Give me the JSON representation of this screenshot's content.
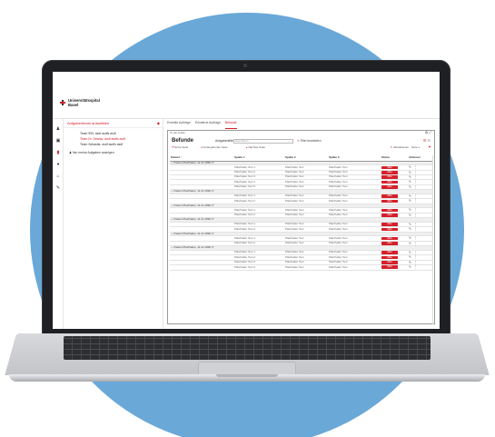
{
  "brand": {
    "line1": "Universitätsspital",
    "line2": "Basel"
  },
  "tasks": {
    "header": "Aufgabenteam auswählen",
    "teams": [
      {
        "label": "Team 990, asdf asdfs asdf",
        "active": false
      },
      {
        "label": "Team Dr. Sewiss, asdf asdfs asdf",
        "active": true
      },
      {
        "label": "Team Sebastia, asdf asdfs asdf",
        "active": false
      }
    ],
    "mine": "Nur meine Aufgaben anzeigen"
  },
  "tabs": [
    {
      "label": "Erstellte Aufträge",
      "active": false
    },
    {
      "label": "Erhaltene Aufträge",
      "active": false
    },
    {
      "label": "Befunde",
      "active": true
    }
  ],
  "card": {
    "back_link": "To die subtle",
    "title": "Befunde",
    "filter_label": "Aufgabenfilter",
    "filter_placeholder": "Das Filtern",
    "filter_reset": "Filter bearbeiten",
    "actions": {
      "first": "Erste Seite",
      "prev": "Vorangehende Seite",
      "next": "Nächste Seite",
      "refresh": "Aktualisieren",
      "page": "Seite 1"
    }
  },
  "table": {
    "columns": [
      "Patient",
      "Spalte 1",
      "Spalte 2",
      "Spalte 3",
      "Status",
      "Aktionen"
    ],
    "status_label": "offen",
    "groups": [
      {
        "label": "Patient Platzhalter, 11.11.1998, P",
        "rows": [
          [
            "Platzhalter Text 1",
            "Platzhalter Text",
            "Platzhalter Text"
          ],
          [
            "Platzhalter Text 2",
            "Platzhalter Text",
            "Platzhalter Text"
          ],
          [
            "Platzhalter Text 3",
            "Platzhalter Text",
            "Platzhalter Text"
          ],
          [
            "Platzhalter Text 4",
            "Platzhalter Text",
            "Platzhalter Text"
          ],
          [
            "Platzhalter Text 5",
            "Platzhalter Text",
            "Platzhalter Text"
          ]
        ]
      },
      {
        "label": "Patient Platzhalter, 11.11.1998, P",
        "rows": [
          [
            "Platzhalter Text 1",
            "Platzhalter Text",
            "Platzhalter Text"
          ],
          [
            "Platzhalter Text 2",
            "Platzhalter Text",
            "Platzhalter Text"
          ]
        ]
      },
      {
        "label": "Patient Platzhalter, 11.11.1998, P",
        "rows": [
          [
            "Platzhalter Text 1",
            "Platzhalter Text",
            "Platzhalter Text"
          ],
          [
            "Platzhalter Text 2",
            "Platzhalter Text",
            "Platzhalter Text"
          ]
        ]
      },
      {
        "label": "Patient Platzhalter, 11.11.1998, P",
        "rows": [
          [
            "Platzhalter Text 1",
            "Platzhalter Text",
            "Platzhalter Text"
          ],
          [
            "Platzhalter Text 2",
            "Platzhalter Text",
            "Platzhalter Text"
          ]
        ]
      },
      {
        "label": "Patient Platzhalter, 11.11.1998, P",
        "rows": [
          [
            "Platzhalter Text 1",
            "Platzhalter Text",
            "Platzhalter Text"
          ],
          [
            "Platzhalter Text 2",
            "Platzhalter Text",
            "Platzhalter Text"
          ]
        ]
      },
      {
        "label": "Patient Platzhalter, 11.11.1998, P",
        "rows": [
          [
            "Platzhalter Text 1",
            "Platzhalter Text",
            "Platzhalter Text"
          ],
          [
            "Platzhalter Text 2",
            "Platzhalter Text",
            "Platzhalter Text"
          ],
          [
            "Platzhalter Text 3",
            "Platzhalter Text",
            "Platzhalter Text"
          ],
          [
            "Platzhalter Text 4",
            "Platzhalter Text",
            "Platzhalter Text"
          ]
        ]
      }
    ]
  },
  "icons": [
    "home-icon",
    "inbox-icon",
    "document-icon",
    "bell-icon",
    "cart-icon",
    "pen-icon",
    "more-icon",
    "refresh-icon",
    "filter-icon"
  ],
  "colors": {
    "accent": "#d4202a",
    "background_circle": "#6aa8d8"
  }
}
